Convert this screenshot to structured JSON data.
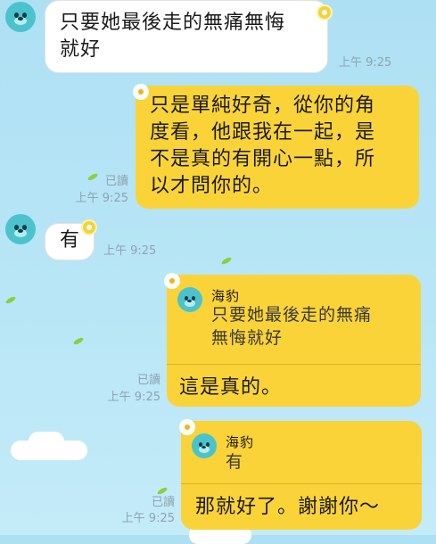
{
  "messages": [
    {
      "text": "只要她最後走的無痛無悔\n就好",
      "time": "上午 9:25"
    },
    {
      "text": "只是單純好奇，從你的角\n度看，他跟我在一起，是\n不是真的有開心一點，所\n以才問你的。",
      "read": "已讀",
      "time": "上午 9:25"
    },
    {
      "text": "有",
      "time": "上午 9:25"
    },
    {
      "reply_to": {
        "name": "海豹",
        "text": "只要她最後走的無痛\n無悔就好"
      },
      "text": "這是真的。",
      "read": "已讀",
      "time": "上午 9:25"
    },
    {
      "reply_to": {
        "name": "海豹",
        "text": "有"
      },
      "text": "那就好了。謝謝你～",
      "read": "已讀",
      "time": "上午 9:25"
    }
  ],
  "colors": {
    "background": "#b8e6f6",
    "out_bubble": "#fad339",
    "in_bubble": "#ffffff",
    "avatar": "#4cc3cc"
  },
  "icons": {
    "avatar": "seal-avatar-icon",
    "decoration": "flower-icon"
  }
}
